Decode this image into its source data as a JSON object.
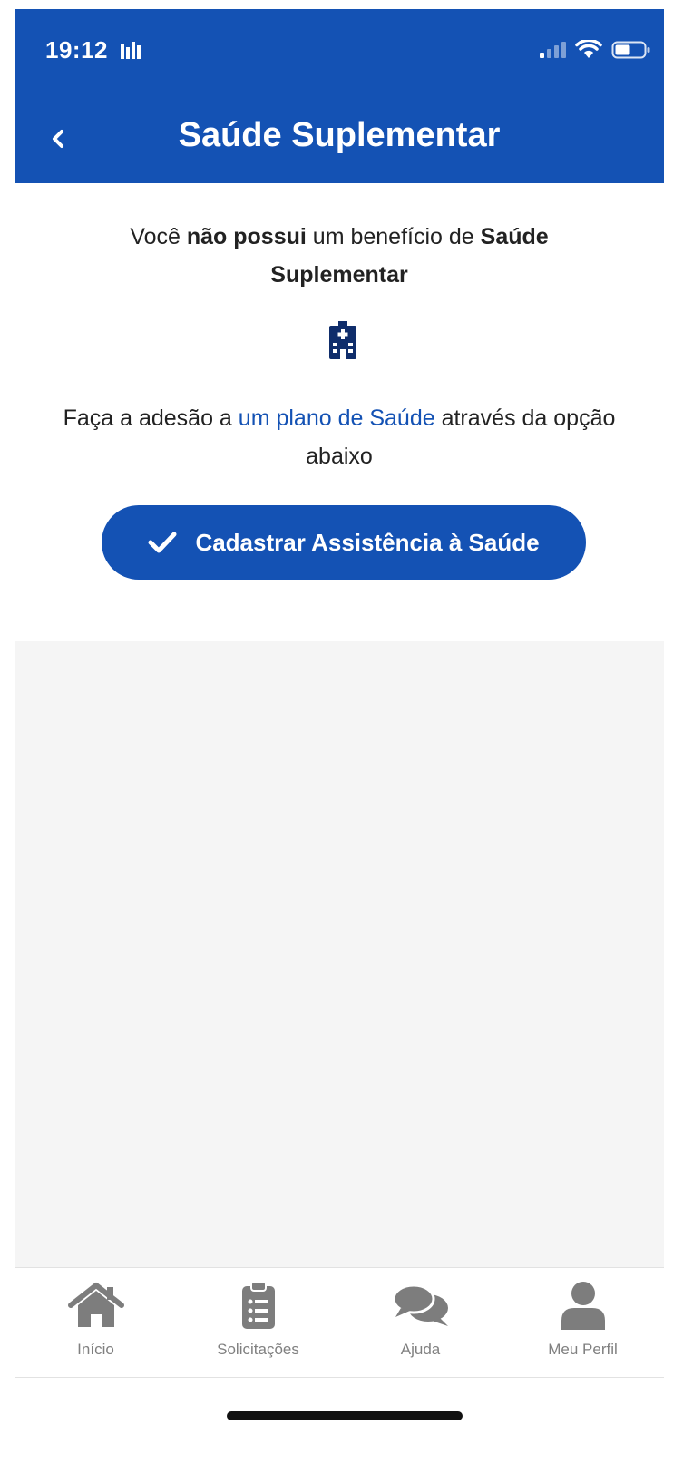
{
  "status_bar": {
    "time": "19:12"
  },
  "header": {
    "title": "Saúde Suplementar"
  },
  "message": {
    "part1": "Você ",
    "bold1": "não possui",
    "part2": " um benefício de ",
    "bold2": "Saúde Suplementar"
  },
  "instruction": {
    "part1": "Faça a adesão a ",
    "link": "um plano de Saúde",
    "part2": " através da opção abaixo"
  },
  "cta": {
    "label": "Cadastrar Assistência à Saúde",
    "icon": "check-icon"
  },
  "tabs": [
    {
      "label": "Início",
      "icon": "home-icon"
    },
    {
      "label": "Solicitações",
      "icon": "clipboard-list-icon"
    },
    {
      "label": "Ajuda",
      "icon": "chat-bubbles-icon"
    },
    {
      "label": "Meu Perfil",
      "icon": "user-icon"
    }
  ],
  "colors": {
    "primary": "#1452b4",
    "tab_icon": "#7d7d7d",
    "background_gray": "#f5f5f5"
  }
}
